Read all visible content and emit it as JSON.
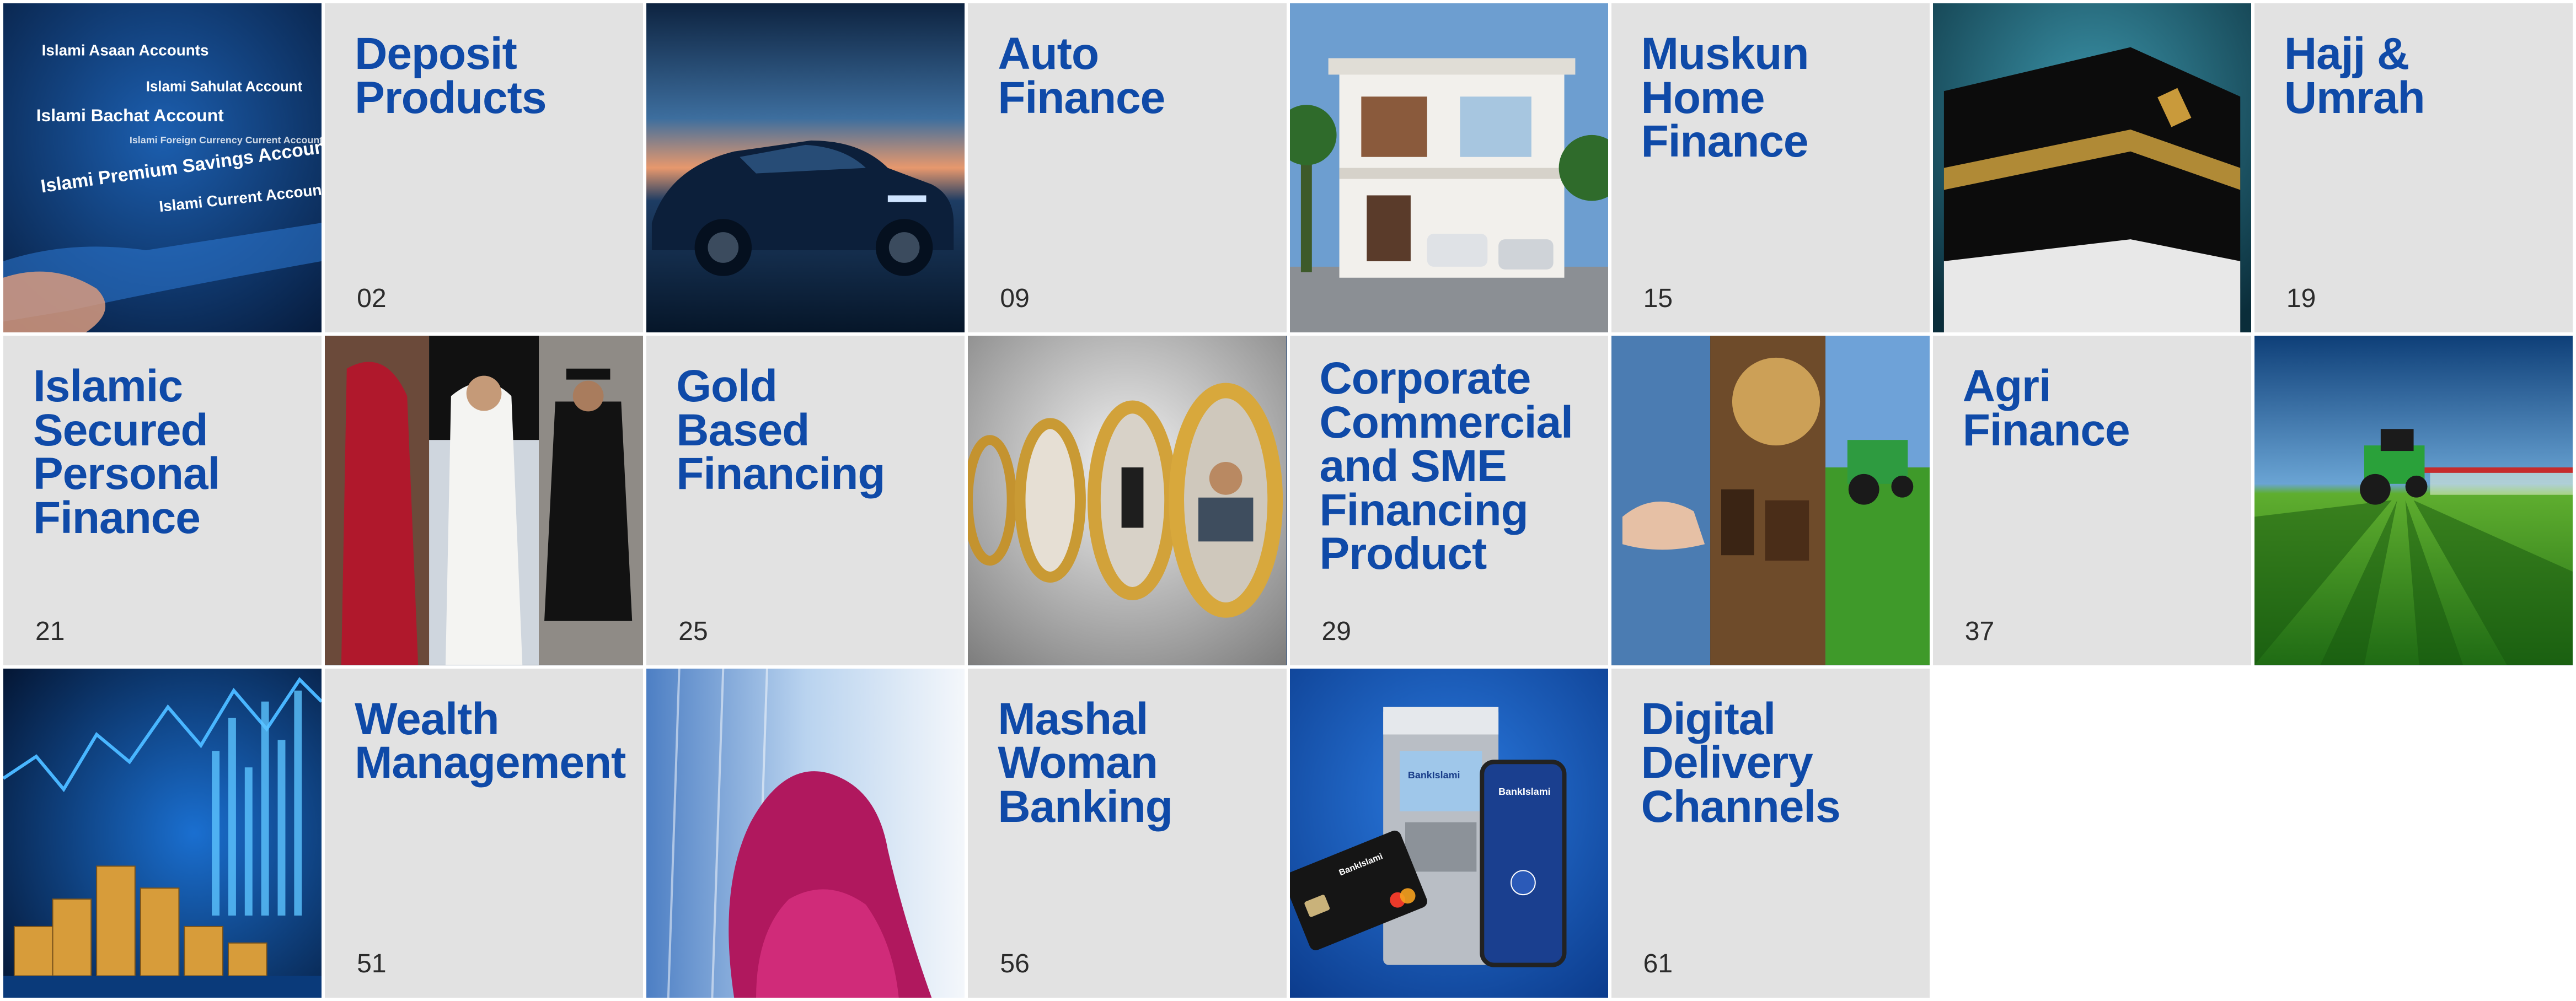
{
  "sections": {
    "deposit": {
      "title": "Deposit\nProducts",
      "page": "02"
    },
    "auto": {
      "title": "Auto\nFinance",
      "page": "09"
    },
    "muskun": {
      "title": "Muskun\nHome\nFinance",
      "page": "15"
    },
    "hajj": {
      "title": "Hajj &\nUmrah",
      "page": "19"
    },
    "personal": {
      "title": "Islamic\nSecured\nPersonal\nFinance",
      "page": "21"
    },
    "gold": {
      "title": "Gold\nBased\nFinancing",
      "page": "25"
    },
    "corporate": {
      "title": "Corporate\nCommercial\nand SME\nFinancing\nProduct",
      "page": "29"
    },
    "agri": {
      "title": "Agri\nFinance",
      "page": "37"
    },
    "wealth": {
      "title": "Wealth\nManagement",
      "page": "51"
    },
    "mashal": {
      "title": "Mashal\nWoman\nBanking",
      "page": "56"
    },
    "digital": {
      "title": "Digital\nDelivery\nChannels",
      "page": "61"
    }
  },
  "deposit_image_text": [
    "Islami Asaan Accounts",
    "Islami Sahulat Account",
    "Islami Bachat Account",
    "Islami Foreign Currency Current Account",
    "Islami Premium Savings Account",
    "Islami Current Account"
  ],
  "card_text": {
    "bank_name": "BankIslami",
    "atm_brand": "BankIslami",
    "phone_brand": "BankIslami"
  },
  "colors": {
    "title": "#0f4aa8",
    "tile_bg": "#e2e2e2",
    "page_number": "#2b2b2b"
  }
}
